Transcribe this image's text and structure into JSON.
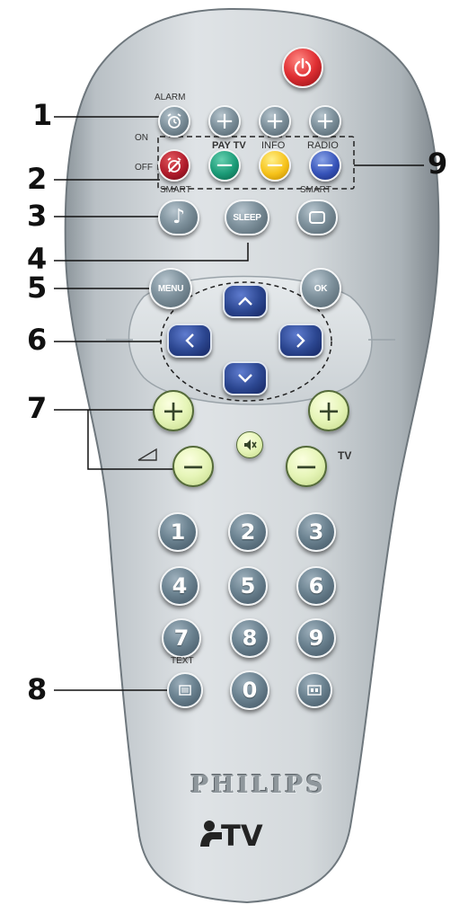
{
  "callouts": [
    "1",
    "2",
    "3",
    "4",
    "5",
    "6",
    "7",
    "8",
    "9"
  ],
  "labels": {
    "alarm": "ALARM",
    "on": "ON",
    "off": "OFF",
    "pay_tv": "PAY TV",
    "info": "INFO",
    "radio": "RADIO",
    "smart_left": "SMART",
    "smart_right": "SMART",
    "text": "TEXT",
    "tv": "TV"
  },
  "buttons": {
    "sleep": "SLEEP",
    "menu": "MENU",
    "ok": "OK"
  },
  "number_keys": [
    "1",
    "2",
    "3",
    "4",
    "5",
    "6",
    "7",
    "8",
    "9",
    "0"
  ],
  "brand": {
    "name": "PHILIPS",
    "product": "TV"
  },
  "icons": {
    "power": "power-icon",
    "alarm": "alarm-clock-icon",
    "alarm_off": "alarm-off-icon",
    "plus": "plus-icon",
    "minus": "minus-icon",
    "sound": "music-note-icon",
    "picture": "screen-icon",
    "mute": "mute-icon",
    "volume": "volume-wedge-icon",
    "teletext": "teletext-icon",
    "av": "av-input-icon",
    "arrows": [
      "arrow-up-icon",
      "arrow-left-icon",
      "arrow-right-icon",
      "arrow-down-icon"
    ]
  },
  "colors": {
    "red": "#b01b2b",
    "green": "#1a9a76",
    "yellow": "#f6c21a",
    "blue": "#3552b8",
    "navigation": "#2c4791",
    "volume_program": "#e6f5b8",
    "body": "#c8ced2"
  }
}
